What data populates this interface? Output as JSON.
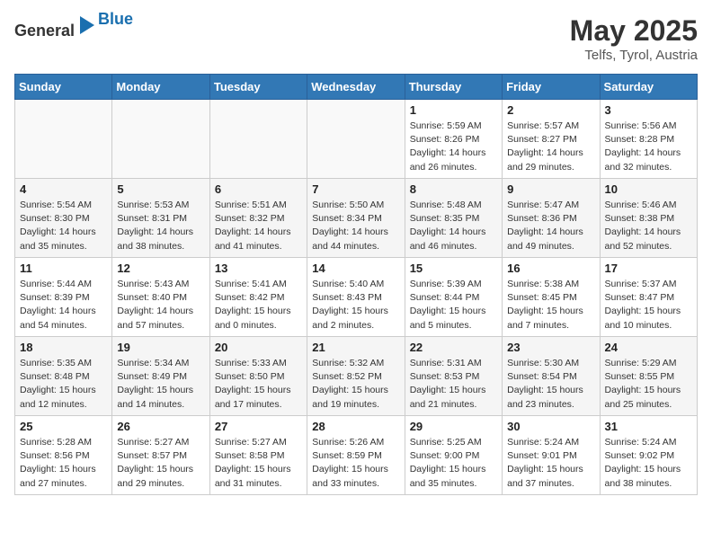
{
  "header": {
    "logo_general": "General",
    "logo_blue": "Blue",
    "month": "May 2025",
    "location": "Telfs, Tyrol, Austria"
  },
  "days_of_week": [
    "Sunday",
    "Monday",
    "Tuesday",
    "Wednesday",
    "Thursday",
    "Friday",
    "Saturday"
  ],
  "weeks": [
    [
      {
        "day": "",
        "info": ""
      },
      {
        "day": "",
        "info": ""
      },
      {
        "day": "",
        "info": ""
      },
      {
        "day": "",
        "info": ""
      },
      {
        "day": "1",
        "info": "Sunrise: 5:59 AM\nSunset: 8:26 PM\nDaylight: 14 hours\nand 26 minutes."
      },
      {
        "day": "2",
        "info": "Sunrise: 5:57 AM\nSunset: 8:27 PM\nDaylight: 14 hours\nand 29 minutes."
      },
      {
        "day": "3",
        "info": "Sunrise: 5:56 AM\nSunset: 8:28 PM\nDaylight: 14 hours\nand 32 minutes."
      }
    ],
    [
      {
        "day": "4",
        "info": "Sunrise: 5:54 AM\nSunset: 8:30 PM\nDaylight: 14 hours\nand 35 minutes."
      },
      {
        "day": "5",
        "info": "Sunrise: 5:53 AM\nSunset: 8:31 PM\nDaylight: 14 hours\nand 38 minutes."
      },
      {
        "day": "6",
        "info": "Sunrise: 5:51 AM\nSunset: 8:32 PM\nDaylight: 14 hours\nand 41 minutes."
      },
      {
        "day": "7",
        "info": "Sunrise: 5:50 AM\nSunset: 8:34 PM\nDaylight: 14 hours\nand 44 minutes."
      },
      {
        "day": "8",
        "info": "Sunrise: 5:48 AM\nSunset: 8:35 PM\nDaylight: 14 hours\nand 46 minutes."
      },
      {
        "day": "9",
        "info": "Sunrise: 5:47 AM\nSunset: 8:36 PM\nDaylight: 14 hours\nand 49 minutes."
      },
      {
        "day": "10",
        "info": "Sunrise: 5:46 AM\nSunset: 8:38 PM\nDaylight: 14 hours\nand 52 minutes."
      }
    ],
    [
      {
        "day": "11",
        "info": "Sunrise: 5:44 AM\nSunset: 8:39 PM\nDaylight: 14 hours\nand 54 minutes."
      },
      {
        "day": "12",
        "info": "Sunrise: 5:43 AM\nSunset: 8:40 PM\nDaylight: 14 hours\nand 57 minutes."
      },
      {
        "day": "13",
        "info": "Sunrise: 5:41 AM\nSunset: 8:42 PM\nDaylight: 15 hours\nand 0 minutes."
      },
      {
        "day": "14",
        "info": "Sunrise: 5:40 AM\nSunset: 8:43 PM\nDaylight: 15 hours\nand 2 minutes."
      },
      {
        "day": "15",
        "info": "Sunrise: 5:39 AM\nSunset: 8:44 PM\nDaylight: 15 hours\nand 5 minutes."
      },
      {
        "day": "16",
        "info": "Sunrise: 5:38 AM\nSunset: 8:45 PM\nDaylight: 15 hours\nand 7 minutes."
      },
      {
        "day": "17",
        "info": "Sunrise: 5:37 AM\nSunset: 8:47 PM\nDaylight: 15 hours\nand 10 minutes."
      }
    ],
    [
      {
        "day": "18",
        "info": "Sunrise: 5:35 AM\nSunset: 8:48 PM\nDaylight: 15 hours\nand 12 minutes."
      },
      {
        "day": "19",
        "info": "Sunrise: 5:34 AM\nSunset: 8:49 PM\nDaylight: 15 hours\nand 14 minutes."
      },
      {
        "day": "20",
        "info": "Sunrise: 5:33 AM\nSunset: 8:50 PM\nDaylight: 15 hours\nand 17 minutes."
      },
      {
        "day": "21",
        "info": "Sunrise: 5:32 AM\nSunset: 8:52 PM\nDaylight: 15 hours\nand 19 minutes."
      },
      {
        "day": "22",
        "info": "Sunrise: 5:31 AM\nSunset: 8:53 PM\nDaylight: 15 hours\nand 21 minutes."
      },
      {
        "day": "23",
        "info": "Sunrise: 5:30 AM\nSunset: 8:54 PM\nDaylight: 15 hours\nand 23 minutes."
      },
      {
        "day": "24",
        "info": "Sunrise: 5:29 AM\nSunset: 8:55 PM\nDaylight: 15 hours\nand 25 minutes."
      }
    ],
    [
      {
        "day": "25",
        "info": "Sunrise: 5:28 AM\nSunset: 8:56 PM\nDaylight: 15 hours\nand 27 minutes."
      },
      {
        "day": "26",
        "info": "Sunrise: 5:27 AM\nSunset: 8:57 PM\nDaylight: 15 hours\nand 29 minutes."
      },
      {
        "day": "27",
        "info": "Sunrise: 5:27 AM\nSunset: 8:58 PM\nDaylight: 15 hours\nand 31 minutes."
      },
      {
        "day": "28",
        "info": "Sunrise: 5:26 AM\nSunset: 8:59 PM\nDaylight: 15 hours\nand 33 minutes."
      },
      {
        "day": "29",
        "info": "Sunrise: 5:25 AM\nSunset: 9:00 PM\nDaylight: 15 hours\nand 35 minutes."
      },
      {
        "day": "30",
        "info": "Sunrise: 5:24 AM\nSunset: 9:01 PM\nDaylight: 15 hours\nand 37 minutes."
      },
      {
        "day": "31",
        "info": "Sunrise: 5:24 AM\nSunset: 9:02 PM\nDaylight: 15 hours\nand 38 minutes."
      }
    ]
  ]
}
